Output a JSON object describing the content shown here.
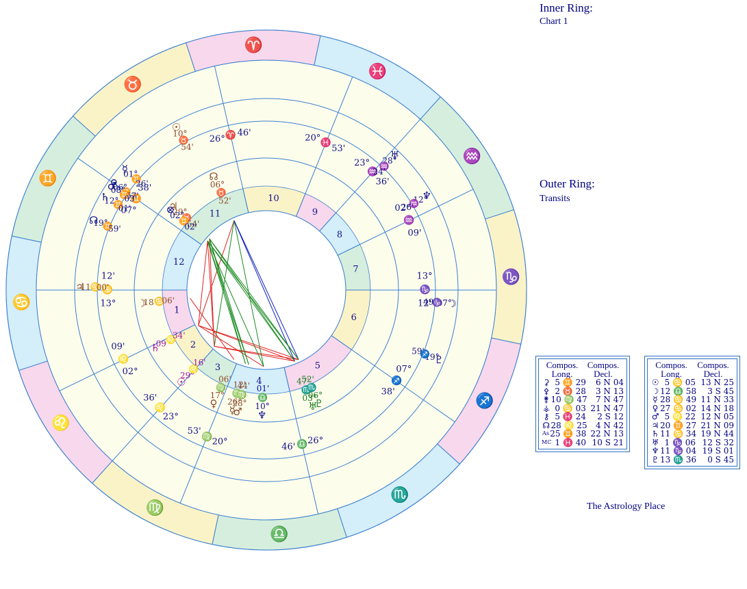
{
  "chart_data": {
    "type": "astrology-biwheel",
    "zodiac_ring": [
      "♈",
      "♉",
      "♊",
      "♋",
      "♌",
      "♍",
      "♎",
      "♏",
      "♐",
      "♑",
      "♒",
      "♓"
    ],
    "house_numbers": [
      "1",
      "2",
      "3",
      "4",
      "5",
      "6",
      "7",
      "8",
      "9",
      "10",
      "11",
      "12"
    ],
    "house_cusps": [
      {
        "deg": "13°",
        "sign": "♋",
        "min": "12'"
      },
      {
        "deg": "02°",
        "sign": "♌",
        "min": "09'"
      },
      {
        "deg": "23°",
        "sign": "♌",
        "min": "36'"
      },
      {
        "deg": "20°",
        "sign": "♍",
        "min": "53'"
      },
      {
        "deg": "26°",
        "sign": "♎",
        "min": "46'"
      },
      {
        "deg": "07°",
        "sign": "♐",
        "min": "38'"
      },
      {
        "deg": "13°",
        "sign": "♑",
        "min": "12'"
      },
      {
        "deg": "02°",
        "sign": "♒",
        "min": "09'"
      },
      {
        "deg": "23°",
        "sign": "♒",
        "min": "36'"
      },
      {
        "deg": "20°",
        "sign": "♓",
        "min": "53'"
      },
      {
        "deg": "26°",
        "sign": "♈",
        "min": "46'"
      },
      {
        "deg": "07°",
        "sign": "♊",
        "min": "38'"
      }
    ],
    "inner_planets": [
      {
        "glyph": "☽",
        "deg": "18°",
        "sign": "♋",
        "min": "06'"
      },
      {
        "glyph": "♄",
        "deg": "09°",
        "sign": "♌",
        "min": "34'"
      },
      {
        "glyph": "☉",
        "deg": "29°",
        "sign": "♌",
        "min": "16'"
      },
      {
        "glyph": "♀",
        "deg": "17°",
        "sign": "♍",
        "min": "06'"
      },
      {
        "glyph": "☿",
        "deg": "26°",
        "sign": "♍",
        "min": "12'"
      },
      {
        "glyph": "♂",
        "deg": "28°",
        "sign": "♍",
        "min": "44'"
      },
      {
        "glyph": "♆",
        "deg": "10°",
        "sign": "♎",
        "min": "01'"
      },
      {
        "glyph": "♅",
        "deg": "03°",
        "sign": "♏",
        "min": "47'"
      },
      {
        "glyph": "♇",
        "deg": "06°",
        "sign": "♏",
        "min": "52'"
      },
      {
        "glyph": "☊",
        "deg": "06°",
        "sign": "♉",
        "min": "52'"
      },
      {
        "glyph": "♃",
        "deg": "29°",
        "sign": "♉",
        "min": "54'"
      },
      {
        "glyph": "⊗",
        "deg": "02°",
        "sign": "♊",
        "min": "02'"
      }
    ],
    "outer_planets": [
      {
        "glyph": "♃",
        "deg": "11°",
        "sign": "♋",
        "min": "00'"
      },
      {
        "glyph": "☉",
        "deg": "10°",
        "sign": "♉",
        "min": "54'"
      },
      {
        "glyph": "☿",
        "deg": "01°",
        "sign": "♊",
        "min": "26'"
      },
      {
        "glyph": "♀",
        "deg": "06°",
        "sign": "♊",
        "min": "57'"
      },
      {
        "glyph": "♂",
        "deg": "08°",
        "sign": "♊",
        "min": "03'"
      },
      {
        "glyph": "♄",
        "deg": "12°",
        "sign": "♊",
        "min": "01'"
      },
      {
        "glyph": "☊",
        "deg": "19°",
        "sign": "♊",
        "min": "59'"
      },
      {
        "glyph": "♅",
        "deg": "28°",
        "sign": "♒",
        "min": "24'"
      },
      {
        "glyph": "♆",
        "deg": "12°",
        "sign": "♒",
        "min": "26'"
      },
      {
        "glyph": "☽",
        "deg": "07°",
        "sign": "♑",
        "min": "49'"
      },
      {
        "glyph": "♇",
        "deg": "19°",
        "sign": "♐",
        "min": "59'"
      }
    ]
  },
  "titles": {
    "inner_heading": "Inner Ring:",
    "inner_name": "Chart 1",
    "outer_heading": "Outer Ring:",
    "outer_name": "Transits",
    "footer": "The Astrology Place"
  },
  "table1": {
    "head_long": "Compos.",
    "head_long2": "Long.",
    "head_decl": "Compos.",
    "head_decl2": "Decl.",
    "rows": [
      {
        "g": "⚳",
        "lon": "5 ♊ 29",
        "dec": "6 N 04"
      },
      {
        "g": "⚴",
        "lon": "2 ♉ 28",
        "dec": "3 N 13"
      },
      {
        "g": "⚵",
        "lon": "10 ♍ 47",
        "dec": "7 N 47"
      },
      {
        "g": "⚶",
        "lon": "0 ♋ 03",
        "dec": "21 N 47"
      },
      {
        "g": "⚷",
        "lon": "5 ♓ 24",
        "dec": "2 S 12"
      },
      {
        "g": "☊",
        "lon": "28 ♌ 25",
        "dec": "4 N 42"
      },
      {
        "g": "As",
        "lon": "25 ♊ 38",
        "dec": "22 N 13"
      },
      {
        "g": "MC",
        "lon": "1 ♓ 40",
        "dec": "10 S 21"
      }
    ]
  },
  "table2": {
    "head_long": "Compos.",
    "head_long2": "Long.",
    "head_decl": "Compos.",
    "head_decl2": "Decl.",
    "rows": [
      {
        "g": "☉",
        "lon": "5 ♋ 05",
        "dec": "13 N 25"
      },
      {
        "g": "☽",
        "lon": "12 ♎ 58",
        "dec": "3 S 45"
      },
      {
        "g": "☿",
        "lon": "28 ♋ 49",
        "dec": "11 N 33"
      },
      {
        "g": "♀",
        "lon": "27 ♋ 02",
        "dec": "14 N 18"
      },
      {
        "g": "♂",
        "lon": "5 ♌ 22",
        "dec": "12 N 05"
      },
      {
        "g": "♃",
        "lon": "20 ♊ 27",
        "dec": "21 N 09"
      },
      {
        "g": "♄",
        "lon": "11 ♋ 34",
        "dec": "19 N 44"
      },
      {
        "g": "♅",
        "lon": "1 ♑ 06",
        "dec": "12 S 32"
      },
      {
        "g": "♆",
        "lon": "11 ♑ 04",
        "dec": "19 S 01"
      },
      {
        "g": "♇",
        "lon": "13 ♏ 36",
        "dec": "0 S 45"
      }
    ]
  },
  "colors": {
    "line_blue": "#3a7fd0",
    "ink_blue": "#10108a",
    "ink_brown": "#8a4a2a",
    "ink_purple": "#a0149a",
    "ink_green": "#1a7a20",
    "fire": "#f8d8ec",
    "earth": "#fbf3c8",
    "air": "#d6eedd",
    "water": "#d4eefa",
    "wheel_fill": "#fdfdec"
  }
}
